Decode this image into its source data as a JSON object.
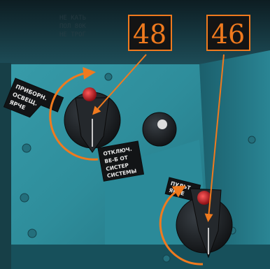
{
  "callouts": [
    {
      "number": "48"
    },
    {
      "number": "46"
    }
  ],
  "plates": {
    "upper_left": {
      "lines": [
        "ПРИБОРН.",
        "ОСВЕЩ.",
        "ЯРЧЕ"
      ]
    },
    "center": {
      "lines": [
        "ОТКЛЮЧ.",
        "ВЕ-Б ОТ",
        "СИСТЕР",
        "СИСТЕМЫ"
      ]
    },
    "lower": {
      "lines": [
        "ПУЛЬТ.",
        "ЯРЧЕ"
      ]
    },
    "top_stencil": {
      "lines": [
        "НЕ КАТЬ",
        "ПОЛ 80К",
        "НЕ ТРОГ"
      ]
    }
  },
  "colors": {
    "panel": "#2e8d9b",
    "panel_dark": "#1f6471",
    "accent_orange": "#f07a1e",
    "knob": "#1b1f23",
    "indicator_red": "#d0202a"
  },
  "icons": [
    "rotation-arrow-icon",
    "knob-icon",
    "indicator-lamp-icon",
    "callout-pointer-icon"
  ]
}
